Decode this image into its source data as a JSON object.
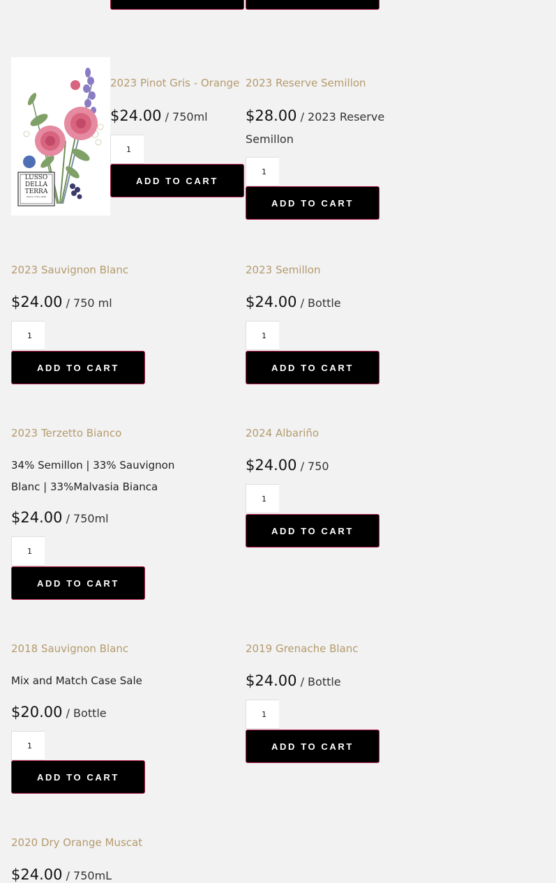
{
  "top_buttons": [
    {
      "label": ""
    },
    {
      "label": ""
    }
  ],
  "products": [
    {
      "title": "2023 Pinot Gris - Orange",
      "price": "$24.00",
      "unit": " / 750ml",
      "qty": "1",
      "button": "ADD TO CART",
      "has_image": true
    },
    {
      "title": "2023 Reserve Semillon",
      "price": "$28.00",
      "unit": " / 2023 Reserve",
      "unit2": "Semillon",
      "qty": "1",
      "button": "ADD TO CART"
    },
    {
      "title": "2023 Sauvignon Blanc",
      "price": "$24.00",
      "unit": " / 750 ml",
      "qty": "1",
      "button": "ADD TO CART"
    },
    {
      "title": "2023 Semillon",
      "price": "$24.00",
      "unit": " / Bottle",
      "qty": "1",
      "button": "ADD TO CART"
    },
    {
      "title": "2023 Terzetto Bianco",
      "description_line1": "34% Semillon | 33% Sauvignon",
      "description_line2": "Blanc | 33%Malvasia Bianca",
      "price": "$24.00",
      "unit": " / 750ml",
      "qty": "1",
      "button": "ADD TO CART"
    },
    {
      "title": "2024 Albariño",
      "price": "$24.00",
      "unit": " / 750",
      "qty": "1",
      "button": "ADD TO CART"
    },
    {
      "title": "2018 Sauvignon Blanc",
      "description_line1": "Mix and Match Case Sale",
      "price": "$20.00",
      "unit": " / Bottle",
      "qty": "1",
      "button": "ADD TO CART"
    },
    {
      "title": "2019 Grenache Blanc",
      "price": "$24.00",
      "unit": " / Bottle",
      "qty": "1",
      "button": "ADD TO CART"
    },
    {
      "title": "2020 Dry Orange Muscat",
      "price": "$24.00",
      "unit": " / 750mL"
    }
  ],
  "label_image": {
    "brand_line1": "LUSSO",
    "brand_line2": "DELLA",
    "brand_line3": "TERRA",
    "tagline": "luxury of the earth"
  },
  "colors": {
    "title": "#b49a6e",
    "button_bg": "#000000",
    "button_border": "#b5214b",
    "page_bg": "#f2f2f2"
  }
}
